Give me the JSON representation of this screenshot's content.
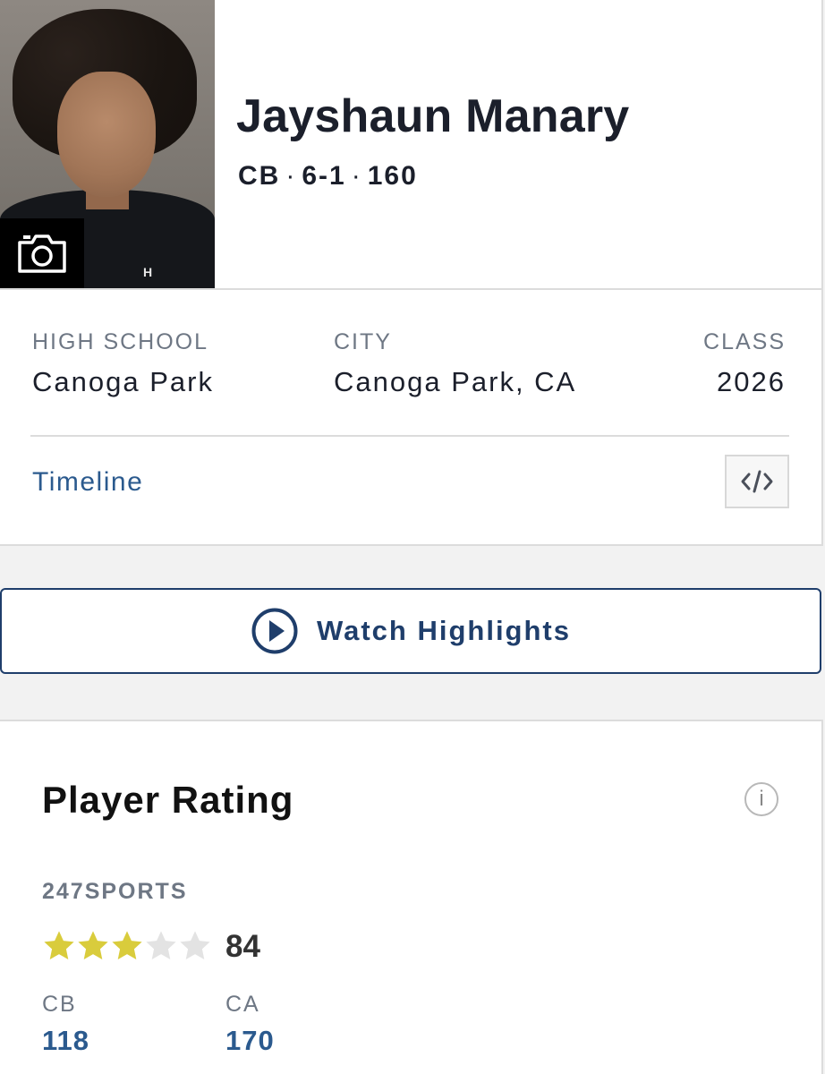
{
  "player": {
    "name": "Jayshaun Manary",
    "position": "CB",
    "height": "6-1",
    "weight": "160",
    "meta_separator": "·",
    "photo_logo": "H"
  },
  "info": {
    "high_school_label": "HIGH SCHOOL",
    "high_school_value": "Canoga Park",
    "city_label": "CITY",
    "city_value": "Canoga Park, CA",
    "class_label": "CLASS",
    "class_value": "2026",
    "timeline_link": "Timeline",
    "embed_icon": "code-embed-icon"
  },
  "highlights": {
    "button_label": "Watch Highlights",
    "icon": "play-circle-icon",
    "accent": "#1f3e6b"
  },
  "rating": {
    "title": "Player Rating",
    "info_glyph": "i",
    "source": "247SPORTS",
    "stars_filled": 3,
    "stars_total": 5,
    "score": "84",
    "position_rank_label": "CB",
    "position_rank_value": "118",
    "state_rank_label": "CA",
    "state_rank_value": "170",
    "star_color": "#d9cc3c",
    "star_empty_color": "#e3e3e3"
  },
  "colors": {
    "link": "#2b5a8e",
    "label_gray": "#6e7784"
  }
}
